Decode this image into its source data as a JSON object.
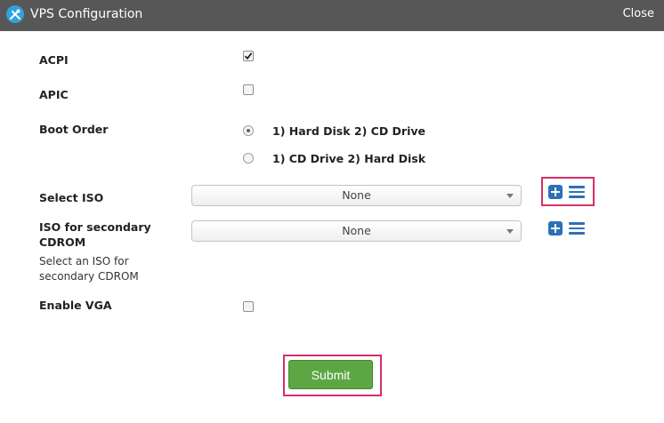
{
  "window": {
    "title": "VPS Configuration",
    "close_label": "Close",
    "app_icon": "tools-icon"
  },
  "form": {
    "acpi": {
      "label": "ACPI",
      "checked": true
    },
    "apic": {
      "label": "APIC",
      "checked": false
    },
    "boot_order": {
      "label": "Boot Order",
      "options": [
        {
          "label": "1) Hard Disk 2) CD Drive",
          "selected": true
        },
        {
          "label": "1) CD Drive 2) Hard Disk",
          "selected": false
        }
      ]
    },
    "select_iso": {
      "label": "Select ISO",
      "value": "None",
      "add_icon": "plus-square-icon",
      "list_icon": "list-icon"
    },
    "secondary_iso": {
      "label_line1": "ISO for secondary",
      "label_line2": "CDROM",
      "help_line1": "Select an ISO for",
      "help_line2": "secondary CDROM",
      "value": "None",
      "add_icon": "plus-square-icon",
      "list_icon": "list-icon"
    },
    "enable_vga": {
      "label": "Enable VGA",
      "checked": false
    }
  },
  "actions": {
    "submit_label": "Submit"
  },
  "colors": {
    "titlebar": "#575757",
    "accent_blue": "#2c70b8",
    "submit_green": "#5ca744",
    "highlight": "#d62e6b"
  }
}
